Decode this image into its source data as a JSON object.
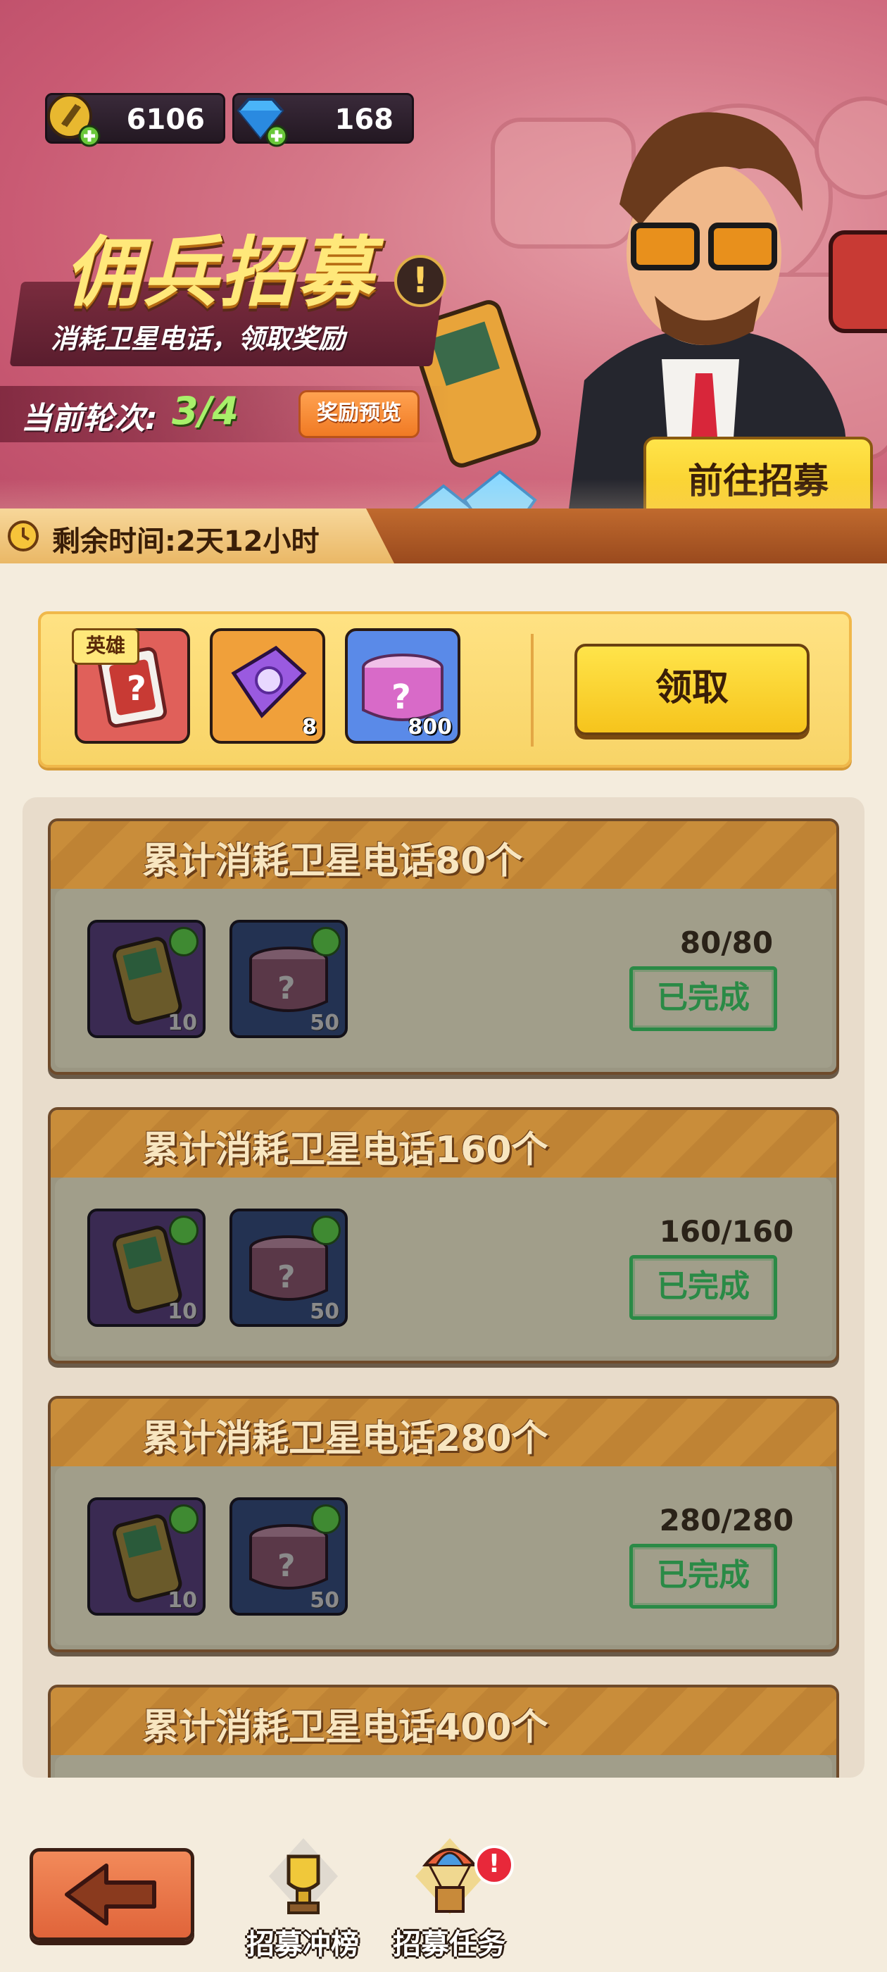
{
  "currency": {
    "gold": {
      "value": "6106",
      "icon": "gold-coin-icon"
    },
    "gems": {
      "value": "168",
      "icon": "diamond-icon"
    }
  },
  "event": {
    "title": "佣兵招募",
    "subtitle": "消耗卫星电话，领取奖励",
    "info_icon": "!",
    "round_label": "当前轮次:",
    "round_value": "3/4",
    "preview_label": "奖励预览",
    "go_label": "前往招募",
    "time_label": "剩余时间:2天12小时"
  },
  "milestone": {
    "items": [
      {
        "name": "hero-card",
        "tag": "英雄",
        "qty": ""
      },
      {
        "name": "purple-chip",
        "tag": "",
        "qty": "8"
      },
      {
        "name": "mystery-can",
        "tag": "",
        "qty": "800"
      }
    ],
    "claim_label": "领取"
  },
  "tasks": [
    {
      "title": "累计消耗卫星电话80个",
      "progress": "80/80",
      "status": "已完成",
      "rewards": [
        {
          "icon": "satellite-phone-icon",
          "qty": "10"
        },
        {
          "icon": "mystery-can-icon",
          "qty": "50"
        }
      ]
    },
    {
      "title": "累计消耗卫星电话160个",
      "progress": "160/160",
      "status": "已完成",
      "rewards": [
        {
          "icon": "satellite-phone-icon",
          "qty": "10"
        },
        {
          "icon": "mystery-can-icon",
          "qty": "50"
        }
      ]
    },
    {
      "title": "累计消耗卫星电话280个",
      "progress": "280/280",
      "status": "已完成",
      "rewards": [
        {
          "icon": "satellite-phone-icon",
          "qty": "10"
        },
        {
          "icon": "mystery-can-icon",
          "qty": "50"
        }
      ]
    },
    {
      "title": "累计消耗卫星电话400个"
    }
  ],
  "nav": {
    "back_icon": "arrow-left-icon",
    "rank_label": "招募冲榜",
    "tasks_label": "招募任务",
    "tasks_badge": "!"
  },
  "colors": {
    "banner_pink": "#d67a8a",
    "gold_button": "#f6c41c",
    "complete_green": "#2a8a46",
    "task_header": "#c98d3a"
  }
}
